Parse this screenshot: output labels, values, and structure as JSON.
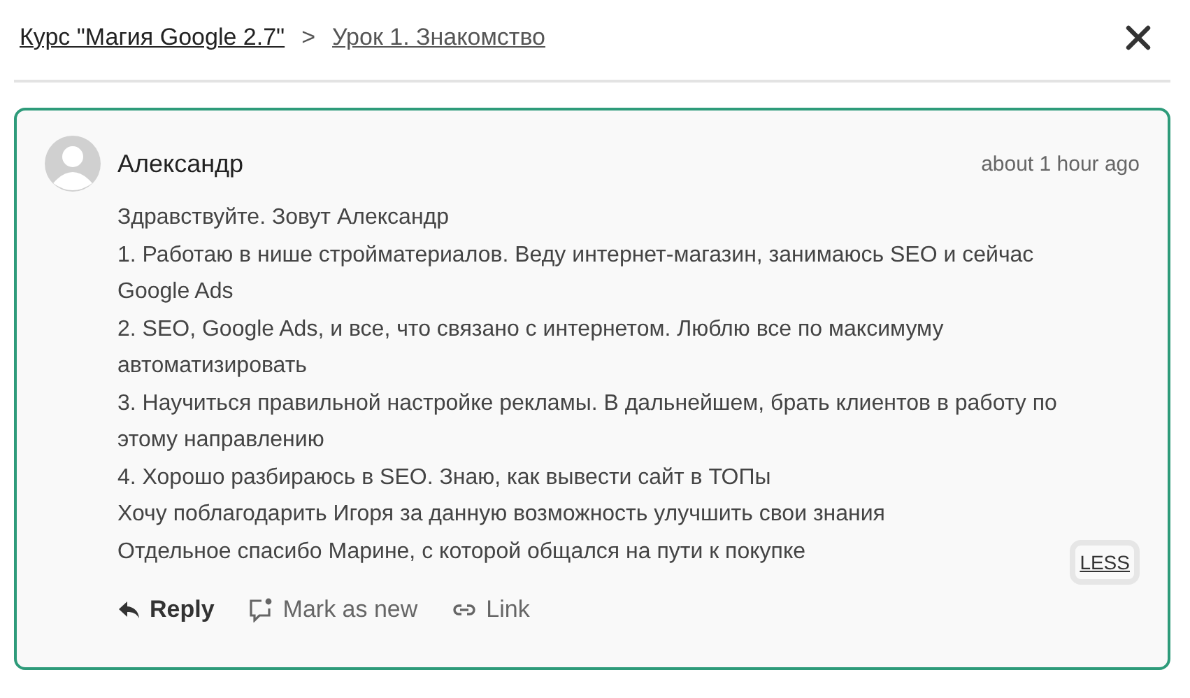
{
  "breadcrumb": [
    {
      "label": "Курс \"Магия Google 2.7\""
    },
    {
      "label": "Урок 1. Знакомство"
    }
  ],
  "breadcrumb_separator": ">",
  "comment": {
    "author": "Александр",
    "time": "about 1 hour ago",
    "paragraphs": [
      "Здравствуйте. Зовут Александр",
      "1. Работаю в нише стройматериалов. Веду интернет-магазин, занимаюсь SEO и сейчас Google Ads",
      "2. SEO, Google Ads, и все, что связано с интернетом. Люблю все по максимуму автоматизировать",
      "3. Научиться правильной настройке рекламы. В дальнейшем, брать клиентов в работу по этому направлению",
      "4. Хорошо разбираюсь в SEO. Знаю, как вывести сайт в ТОПы",
      "Хочу поблагодарить Игоря за данную возможность улучшить свои знания",
      "Отдельное спасибо Марине, с которой общался на пути к покупке"
    ],
    "toggle": "LESS",
    "actions": [
      {
        "kind": "reply",
        "label": "Reply"
      },
      {
        "kind": "mark",
        "label": "Mark as new"
      },
      {
        "kind": "link",
        "label": "Link"
      }
    ]
  }
}
